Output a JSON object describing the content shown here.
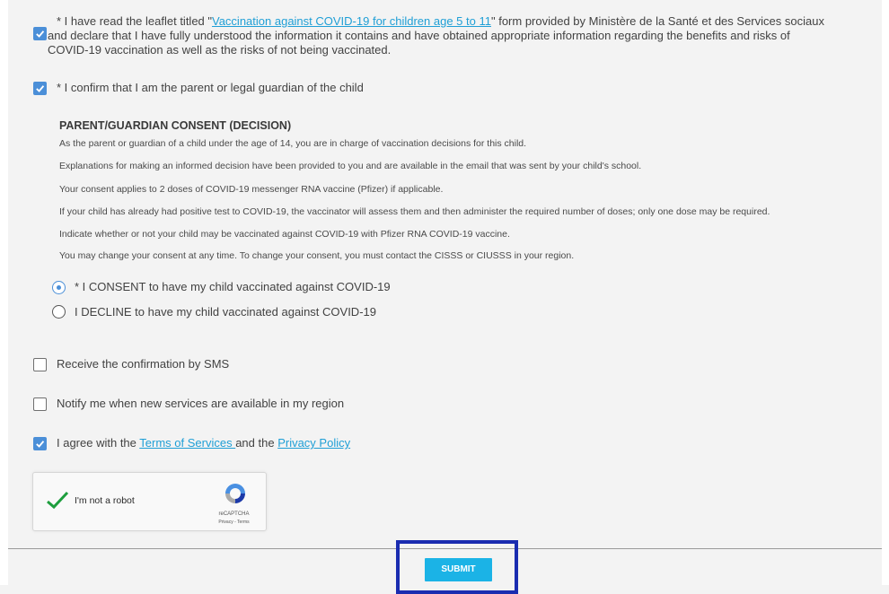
{
  "leaflet": {
    "checked": true,
    "text_pre": "* I have read the leaflet titled \"",
    "link": "Vaccination against COVID-19 for children age 5 to 11",
    "text_post": "\" form provided by Ministère de la Santé et des Services sociaux",
    "line2": "and declare that I have fully understood the information it contains and have obtained appropriate information regarding the benefits and risks of",
    "line3": "COVID-19 vaccination as well as the risks of not being vaccinated."
  },
  "guardian": {
    "checked": true,
    "label": "* I confirm that I am the parent or legal guardian of the child"
  },
  "consent": {
    "title": "PARENT/GUARDIAN CONSENT (DECISION)",
    "paragraphs": [
      "As the parent or guardian of a child under the age of 14, you are in charge of vaccination decisions for this child.",
      "Explanations for making an informed decision have been provided to you and are available in the email that was sent by your child's school.",
      "Your consent applies to 2 doses of COVID-19 messenger RNA vaccine (Pfizer) if applicable.",
      "If your child has already had positive test to COVID-19, the vaccinator will assess them and then administer the required number of doses; only one dose may be required.",
      "Indicate whether or not your child may be vaccinated against COVID-19 with Pfizer RNA COVID-19 vaccine.",
      "You may change your consent at any time. To change your consent, you must contact the CISSS or CIUSSS in your region."
    ],
    "options": [
      {
        "label": "* I CONSENT to have my child vaccinated against COVID-19",
        "selected": true
      },
      {
        "label": "I DECLINE to have my child vaccinated against COVID-19",
        "selected": false
      }
    ]
  },
  "sms": {
    "checked": false,
    "label": "Receive the confirmation by SMS"
  },
  "notify": {
    "checked": false,
    "label": "Notify me when new services are available in my region"
  },
  "terms": {
    "checked": true,
    "pre": "I agree with the ",
    "terms_link": "Terms of Services ",
    "mid": "and the ",
    "privacy_link": "Privacy Policy"
  },
  "recaptcha": {
    "label": "I'm not a robot",
    "brand": "reCAPTCHA",
    "links": "Privacy - Terms"
  },
  "submit": {
    "label": "SUBMIT"
  },
  "colors": {
    "accent": "#4b8fd8",
    "link": "#1f9fd6",
    "submit": "#1bb3e6",
    "highlight": "#1a2cb0"
  }
}
